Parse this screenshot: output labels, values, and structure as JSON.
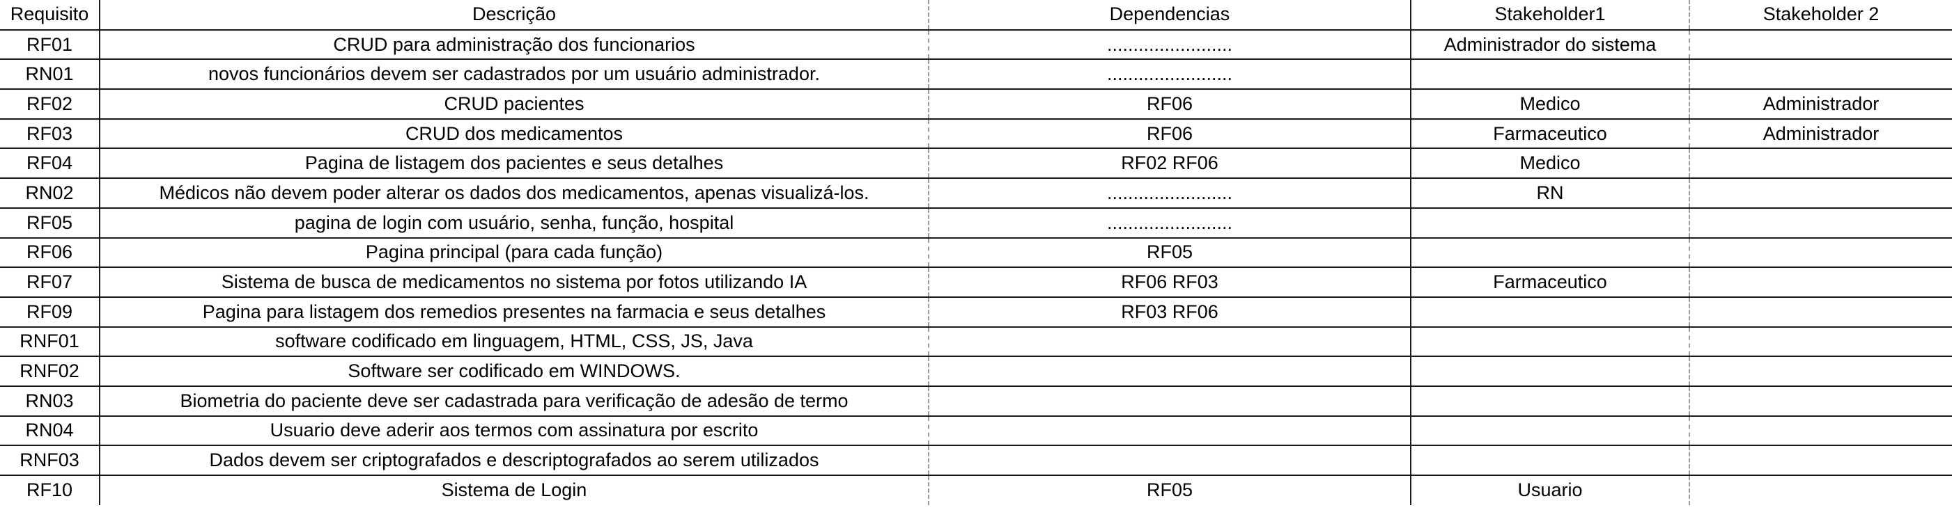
{
  "table": {
    "headers": {
      "requisito": "Requisito",
      "descricao": "Descrição",
      "dependencias": "Dependencias",
      "stakeholder1": "Stakeholder1",
      "stakeholder2": "Stakeholder 2"
    },
    "rows": [
      {
        "requisito": "RF01",
        "descricao": "CRUD para administração dos funcionarios",
        "dependencias": "........................",
        "stakeholder1": "Administrador do sistema",
        "stakeholder2": ""
      },
      {
        "requisito": "RN01",
        "descricao": "novos funcionários devem ser cadastrados por um usuário administrador.",
        "dependencias": "........................",
        "stakeholder1": "",
        "stakeholder2": ""
      },
      {
        "requisito": "RF02",
        "descricao": "CRUD pacientes",
        "dependencias": "RF06",
        "stakeholder1": "Medico",
        "stakeholder2": "Administrador"
      },
      {
        "requisito": "RF03",
        "descricao": "CRUD dos medicamentos",
        "dependencias": "RF06",
        "stakeholder1": "Farmaceutico",
        "stakeholder2": "Administrador"
      },
      {
        "requisito": "RF04",
        "descricao": "Pagina de listagem dos pacientes e seus detalhes",
        "dependencias": "RF02 RF06",
        "stakeholder1": "Medico",
        "stakeholder2": ""
      },
      {
        "requisito": "RN02",
        "descricao": "Médicos não devem poder alterar os dados dos medicamentos, apenas visualizá-los.",
        "dependencias": "........................",
        "stakeholder1": "RN",
        "stakeholder2": ""
      },
      {
        "requisito": "RF05",
        "descricao": "pagina de login com usuário, senha, função, hospital",
        "dependencias": "........................",
        "stakeholder1": "",
        "stakeholder2": ""
      },
      {
        "requisito": "RF06",
        "descricao": "Pagina principal (para cada função)",
        "dependencias": "RF05",
        "stakeholder1": "",
        "stakeholder2": ""
      },
      {
        "requisito": "RF07",
        "descricao": "Sistema de busca de medicamentos no sistema por fotos utilizando IA",
        "dependencias": "RF06 RF03",
        "stakeholder1": "Farmaceutico",
        "stakeholder2": ""
      },
      {
        "requisito": "RF09",
        "descricao": "Pagina para listagem dos remedios presentes na farmacia e seus detalhes",
        "dependencias": "RF03 RF06",
        "stakeholder1": "",
        "stakeholder2": ""
      },
      {
        "requisito": "RNF01",
        "descricao": "software codificado em linguagem, HTML, CSS, JS, Java",
        "dependencias": "",
        "stakeholder1": "",
        "stakeholder2": ""
      },
      {
        "requisito": "RNF02",
        "descricao": "Software ser codificado em WINDOWS.",
        "dependencias": "",
        "stakeholder1": "",
        "stakeholder2": ""
      },
      {
        "requisito": "RN03",
        "descricao": "Biometria do paciente deve ser cadastrada para verificação de adesão de termo",
        "dependencias": "",
        "stakeholder1": "",
        "stakeholder2": ""
      },
      {
        "requisito": "RN04",
        "descricao": "Usuario deve aderir aos termos com assinatura por escrito",
        "dependencias": "",
        "stakeholder1": "",
        "stakeholder2": ""
      },
      {
        "requisito": "RNF03",
        "descricao": "Dados devem ser criptografados e descriptografados ao serem utilizados",
        "dependencias": "",
        "stakeholder1": "",
        "stakeholder2": ""
      },
      {
        "requisito": "RF10",
        "descricao": "Sistema de Login",
        "dependencias": "RF05",
        "stakeholder1": "Usuario",
        "stakeholder2": ""
      }
    ]
  }
}
